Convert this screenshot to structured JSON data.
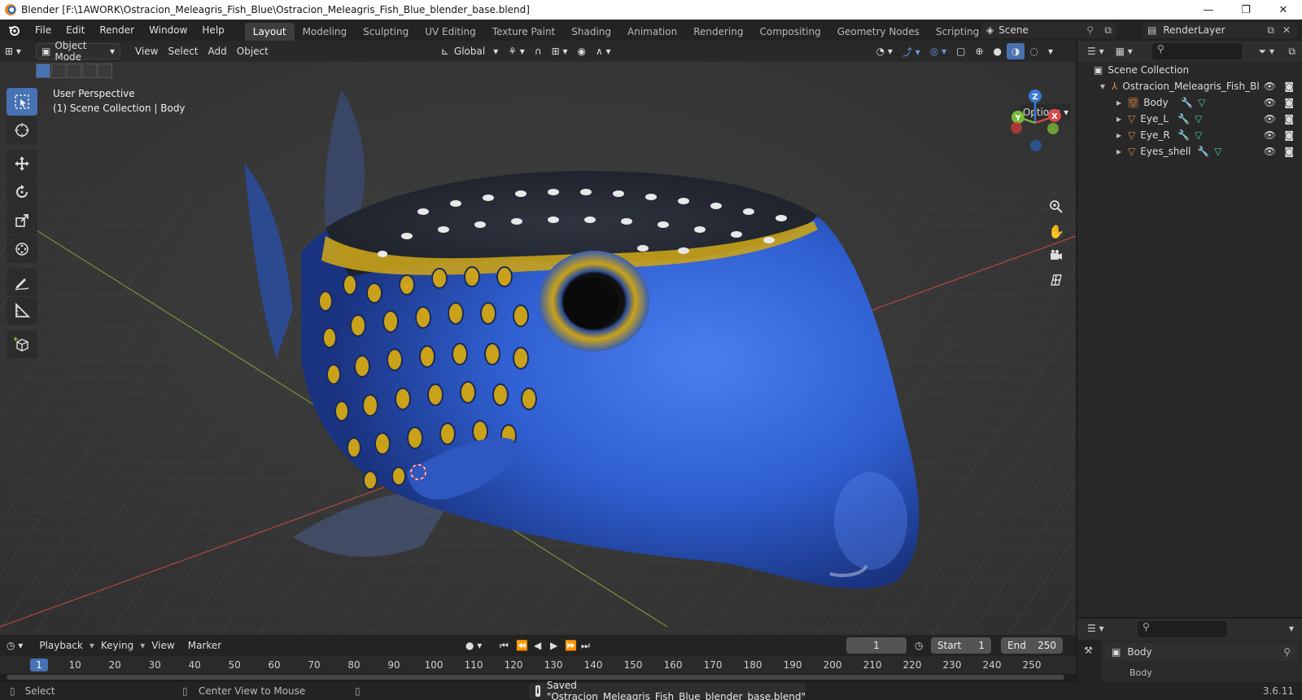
{
  "window": {
    "title": "Blender [F:\\1AWORK\\Ostracion_Meleagris_Fish_Blue\\Ostracion_Meleagris_Fish_Blue_blender_base.blend]",
    "controls": [
      "—",
      "❐",
      "✕"
    ]
  },
  "menu": {
    "items": [
      "File",
      "Edit",
      "Render",
      "Window",
      "Help"
    ]
  },
  "workspaces": {
    "tabs": [
      "Layout",
      "Modeling",
      "Sculpting",
      "UV Editing",
      "Texture Paint",
      "Shading",
      "Animation",
      "Rendering",
      "Compositing",
      "Geometry Nodes",
      "Scripting"
    ],
    "active": "Layout",
    "add": "+"
  },
  "scene": {
    "name": "Scene"
  },
  "render_layer": {
    "name": "RenderLayer"
  },
  "viewport_header": {
    "mode": "Object Mode",
    "menus": [
      "View",
      "Select",
      "Add",
      "Object"
    ],
    "orientation": "Global"
  },
  "viewport": {
    "perspective": "User Perspective",
    "collection_info": "(1) Scene Collection | Body",
    "options": "Options",
    "gizmo": {
      "x": "X",
      "y": "Y",
      "z": "Z"
    }
  },
  "outliner": {
    "root": "Scene Collection",
    "collection": "Ostracion_Meleagris_Fish_Bl",
    "objects": [
      "Body",
      "Eye_L",
      "Eye_R",
      "Eyes_shell"
    ]
  },
  "properties": {
    "object_name": "Body",
    "next_row": "Body"
  },
  "timeline": {
    "menus": [
      "Playback",
      "Keying",
      "View",
      "Marker"
    ],
    "current_frame": "1",
    "start_label": "Start",
    "start": "1",
    "end_label": "End",
    "end": "250",
    "ticks": [
      "1",
      "10",
      "20",
      "30",
      "40",
      "50",
      "60",
      "70",
      "80",
      "90",
      "100",
      "110",
      "120",
      "130",
      "140",
      "150",
      "160",
      "170",
      "180",
      "190",
      "200",
      "210",
      "220",
      "230",
      "240",
      "250"
    ]
  },
  "statusbar": {
    "select": "Select",
    "center": "Center View to Mouse",
    "message": "Saved \"Ostracion_Meleagris_Fish_Blue_blender_base.blend\"",
    "version": "3.6.11"
  },
  "colors": {
    "accent": "#4772b3",
    "fish_blue": "#2f5fd0",
    "fish_yellow": "#c9a21a",
    "object_orange": "#e08a3a",
    "axis_red": "#c94a4a",
    "axis_green": "#7fa43a"
  }
}
